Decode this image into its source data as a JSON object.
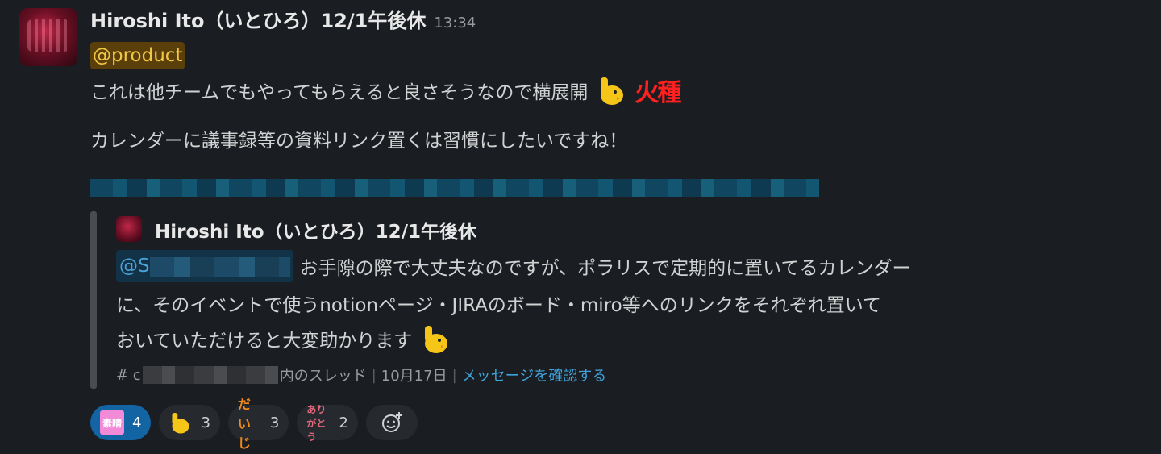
{
  "message": {
    "author": "Hiroshi Ito（いとひろ）12/1午後休",
    "time": "13:34",
    "mention": "@product",
    "line1": "これは他チームでもやってもらえると良さそうなので横展開",
    "line1_emoji": "raised-hand-duck-icon",
    "line1_sticker_text": "火種",
    "line2": "カレンダーに議事録等の資料リンク置くは習慣にしたいですね！"
  },
  "quote": {
    "author": "Hiroshi Ito（いとひろ）12/1午後休",
    "mention_prefix": "@S",
    "line1_rest": "お手隙の際で大丈夫なのですが、ポラリスで定期的に置いてるカレンダー",
    "line2": "に、そのイベントで使うnotionページ・JIRAのボード・miro等へのリンクをそれぞれ置いて",
    "line3": "おいていただけると大変助かります",
    "footer": {
      "channel_prefix": "# c",
      "thread_suffix": "内のスレッド",
      "date": "10月17日",
      "link": "メッセージを確認する"
    }
  },
  "reactions": [
    {
      "icon": "pink-sticker-icon",
      "glyph": "素晴",
      "count": "4",
      "active": true
    },
    {
      "icon": "raised-hand-duck-icon",
      "glyph": "",
      "count": "3",
      "active": false
    },
    {
      "icon": "orange-sticker-icon",
      "glyph": "だいじ",
      "count": "3",
      "active": false
    },
    {
      "icon": "red-sticker-icon",
      "glyph": "ありがとう",
      "count": "2",
      "active": false
    }
  ],
  "colors": {
    "background": "#1a1d21",
    "mention_bg": "#5b3f0b",
    "mention_fg": "#f2c744",
    "link": "#3fa2dc",
    "active_reaction": "#1264a3"
  }
}
